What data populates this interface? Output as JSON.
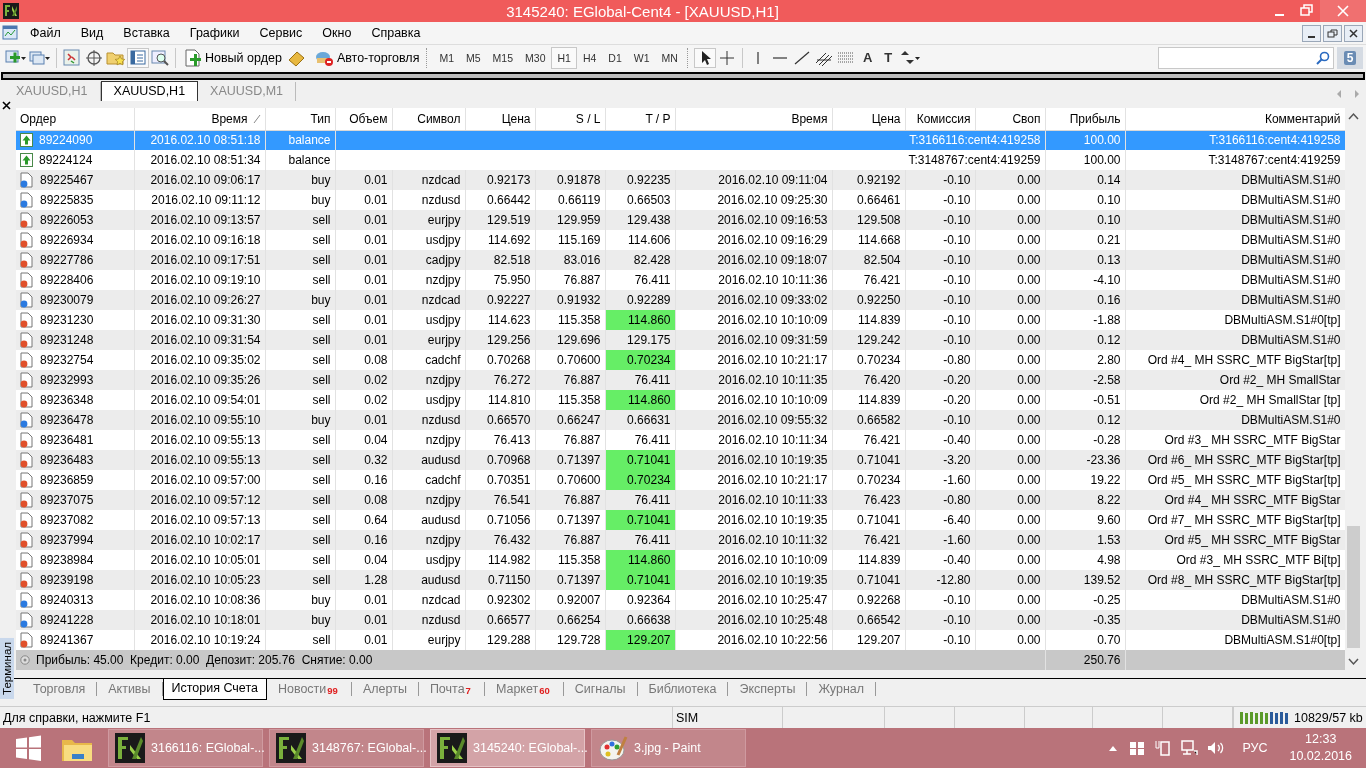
{
  "window": {
    "title": "3145240: EGlobal-Cent4 - [XAUUSD,H1]"
  },
  "menu": [
    "Файл",
    "Вид",
    "Вставка",
    "Графики",
    "Сервис",
    "Окно",
    "Справка"
  ],
  "toolbar": {
    "new_order": "Новый ордер",
    "auto_trading": "Авто-торговля",
    "timeframes": [
      {
        "label": "M1",
        "selected": false
      },
      {
        "label": "M5",
        "selected": false
      },
      {
        "label": "M15",
        "selected": false
      },
      {
        "label": "M30",
        "selected": false
      },
      {
        "label": "H1",
        "selected": true
      },
      {
        "label": "H4",
        "selected": false
      },
      {
        "label": "D1",
        "selected": false
      },
      {
        "label": "W1",
        "selected": false
      },
      {
        "label": "MN",
        "selected": false
      }
    ],
    "text_tools": [
      "A",
      "T"
    ],
    "chat_count": "5"
  },
  "chart_tabs": [
    {
      "label": "XAUUSD,H1",
      "selected": false
    },
    {
      "label": "XAUUSD,H1",
      "selected": true
    },
    {
      "label": "XAUUSD,M1",
      "selected": false
    }
  ],
  "terminal": {
    "title": "Терминал",
    "columns": [
      {
        "label": "Ордер",
        "sorted": false
      },
      {
        "label": "Время",
        "sorted": true
      },
      {
        "label": "Тип",
        "sorted": false
      },
      {
        "label": "Объем",
        "sorted": false
      },
      {
        "label": "Символ",
        "sorted": false
      },
      {
        "label": "Цена",
        "sorted": false
      },
      {
        "label": "S / L",
        "sorted": false
      },
      {
        "label": "T / P",
        "sorted": false
      },
      {
        "label": "Время",
        "sorted": false
      },
      {
        "label": "Цена",
        "sorted": false
      },
      {
        "label": "Комиссия",
        "sorted": false
      },
      {
        "label": "Своп",
        "sorted": false
      },
      {
        "label": "Прибыль",
        "sorted": false
      },
      {
        "label": "Комментарий",
        "sorted": false
      }
    ],
    "rows": [
      {
        "kind": "balance",
        "selected": true,
        "cells": [
          "89224090",
          "2016.02.10 08:51:18",
          "balance"
        ],
        "note": "T:3166116:cent4:419258",
        "profit": "100.00",
        "comment": "T:3166116:cent4:419258"
      },
      {
        "kind": "balance",
        "selected": false,
        "cells": [
          "89224124",
          "2016.02.10 08:51:34",
          "balance"
        ],
        "note": "T:3148767:cent4:419259",
        "profit": "100.00",
        "comment": "T:3148767:cent4:419259"
      },
      {
        "kind": "buy",
        "selected": false,
        "tp_hit": false,
        "cells": [
          "89225467",
          "2016.02.10 09:06:17",
          "buy",
          "0.01",
          "nzdcad",
          "0.92173",
          "0.91878",
          "0.92235",
          "2016.02.10 09:11:04",
          "0.92192",
          "-0.10",
          "0.00",
          "0.14",
          "DBMultiASM.S1#0"
        ]
      },
      {
        "kind": "buy",
        "selected": false,
        "tp_hit": false,
        "cells": [
          "89225835",
          "2016.02.10 09:11:12",
          "buy",
          "0.01",
          "nzdusd",
          "0.66442",
          "0.66119",
          "0.66503",
          "2016.02.10 09:25:30",
          "0.66461",
          "-0.10",
          "0.00",
          "0.10",
          "DBMultiASM.S1#0"
        ]
      },
      {
        "kind": "sell",
        "selected": false,
        "tp_hit": false,
        "cells": [
          "89226053",
          "2016.02.10 09:13:57",
          "sell",
          "0.01",
          "eurjpy",
          "129.519",
          "129.959",
          "129.438",
          "2016.02.10 09:16:53",
          "129.508",
          "-0.10",
          "0.00",
          "0.10",
          "DBMultiASM.S1#0"
        ]
      },
      {
        "kind": "sell",
        "selected": false,
        "tp_hit": false,
        "cells": [
          "89226934",
          "2016.02.10 09:16:18",
          "sell",
          "0.01",
          "usdjpy",
          "114.692",
          "115.169",
          "114.606",
          "2016.02.10 09:16:29",
          "114.668",
          "-0.10",
          "0.00",
          "0.21",
          "DBMultiASM.S1#0"
        ]
      },
      {
        "kind": "sell",
        "selected": false,
        "tp_hit": false,
        "cells": [
          "89227786",
          "2016.02.10 09:17:51",
          "sell",
          "0.01",
          "cadjpy",
          "82.518",
          "83.016",
          "82.428",
          "2016.02.10 09:18:07",
          "82.504",
          "-0.10",
          "0.00",
          "0.13",
          "DBMultiASM.S1#0"
        ]
      },
      {
        "kind": "sell",
        "selected": false,
        "tp_hit": false,
        "cells": [
          "89228406",
          "2016.02.10 09:19:10",
          "sell",
          "0.01",
          "nzdjpy",
          "75.950",
          "76.887",
          "76.411",
          "2016.02.10 10:11:36",
          "76.421",
          "-0.10",
          "0.00",
          "-4.10",
          "DBMultiASM.S1#0"
        ]
      },
      {
        "kind": "buy",
        "selected": false,
        "tp_hit": false,
        "cells": [
          "89230079",
          "2016.02.10 09:26:27",
          "buy",
          "0.01",
          "nzdcad",
          "0.92227",
          "0.91932",
          "0.92289",
          "2016.02.10 09:33:02",
          "0.92250",
          "-0.10",
          "0.00",
          "0.16",
          "DBMultiASM.S1#0"
        ]
      },
      {
        "kind": "sell",
        "selected": false,
        "tp_hit": true,
        "cells": [
          "89231230",
          "2016.02.10 09:31:30",
          "sell",
          "0.01",
          "usdjpy",
          "114.623",
          "115.358",
          "114.860",
          "2016.02.10 10:10:09",
          "114.839",
          "-0.10",
          "0.00",
          "-1.88",
          "DBMultiASM.S1#0[tp]"
        ]
      },
      {
        "kind": "sell",
        "selected": false,
        "tp_hit": false,
        "cells": [
          "89231248",
          "2016.02.10 09:31:54",
          "sell",
          "0.01",
          "eurjpy",
          "129.256",
          "129.696",
          "129.175",
          "2016.02.10 09:31:59",
          "129.242",
          "-0.10",
          "0.00",
          "0.12",
          "DBMultiASM.S1#0"
        ]
      },
      {
        "kind": "sell",
        "selected": false,
        "tp_hit": true,
        "cells": [
          "89232754",
          "2016.02.10 09:35:02",
          "sell",
          "0.08",
          "cadchf",
          "0.70268",
          "0.70600",
          "0.70234",
          "2016.02.10 10:21:17",
          "0.70234",
          "-0.80",
          "0.00",
          "2.80",
          "Ord #4_ MH SSRC_MTF BigStar[tp]"
        ]
      },
      {
        "kind": "sell",
        "selected": false,
        "tp_hit": false,
        "cells": [
          "89232993",
          "2016.02.10 09:35:26",
          "sell",
          "0.02",
          "nzdjpy",
          "76.272",
          "76.887",
          "76.411",
          "2016.02.10 10:11:35",
          "76.420",
          "-0.20",
          "0.00",
          "-2.58",
          "Ord #2_ MH SmallStar"
        ]
      },
      {
        "kind": "sell",
        "selected": false,
        "tp_hit": true,
        "cells": [
          "89236348",
          "2016.02.10 09:54:01",
          "sell",
          "0.02",
          "usdjpy",
          "114.810",
          "115.358",
          "114.860",
          "2016.02.10 10:10:09",
          "114.839",
          "-0.20",
          "0.00",
          "-0.51",
          "Ord #2_ MH SmallStar [tp]"
        ]
      },
      {
        "kind": "buy",
        "selected": false,
        "tp_hit": false,
        "cells": [
          "89236478",
          "2016.02.10 09:55:10",
          "buy",
          "0.01",
          "nzdusd",
          "0.66570",
          "0.66247",
          "0.66631",
          "2016.02.10 09:55:32",
          "0.66582",
          "-0.10",
          "0.00",
          "0.12",
          "DBMultiASM.S1#0"
        ]
      },
      {
        "kind": "sell",
        "selected": false,
        "tp_hit": false,
        "cells": [
          "89236481",
          "2016.02.10 09:55:13",
          "sell",
          "0.04",
          "nzdjpy",
          "76.413",
          "76.887",
          "76.411",
          "2016.02.10 10:11:34",
          "76.421",
          "-0.40",
          "0.00",
          "-0.28",
          "Ord #3_ MH SSRC_MTF BigStar"
        ]
      },
      {
        "kind": "sell",
        "selected": false,
        "tp_hit": true,
        "cells": [
          "89236483",
          "2016.02.10 09:55:13",
          "sell",
          "0.32",
          "audusd",
          "0.70968",
          "0.71397",
          "0.71041",
          "2016.02.10 10:19:35",
          "0.71041",
          "-3.20",
          "0.00",
          "-23.36",
          "Ord #6_ MH SSRC_MTF BigStar[tp]"
        ]
      },
      {
        "kind": "sell",
        "selected": false,
        "tp_hit": true,
        "cells": [
          "89236859",
          "2016.02.10 09:57:00",
          "sell",
          "0.16",
          "cadchf",
          "0.70351",
          "0.70600",
          "0.70234",
          "2016.02.10 10:21:17",
          "0.70234",
          "-1.60",
          "0.00",
          "19.22",
          "Ord #5_ MH SSRC_MTF BigStar[tp]"
        ]
      },
      {
        "kind": "sell",
        "selected": false,
        "tp_hit": false,
        "cells": [
          "89237075",
          "2016.02.10 09:57:12",
          "sell",
          "0.08",
          "nzdjpy",
          "76.541",
          "76.887",
          "76.411",
          "2016.02.10 10:11:33",
          "76.423",
          "-0.80",
          "0.00",
          "8.22",
          "Ord #4_ MH SSRC_MTF BigStar"
        ]
      },
      {
        "kind": "sell",
        "selected": false,
        "tp_hit": true,
        "cells": [
          "89237082",
          "2016.02.10 09:57:13",
          "sell",
          "0.64",
          "audusd",
          "0.71056",
          "0.71397",
          "0.71041",
          "2016.02.10 10:19:35",
          "0.71041",
          "-6.40",
          "0.00",
          "9.60",
          "Ord #7_ MH SSRC_MTF BigStar[tp]"
        ]
      },
      {
        "kind": "sell",
        "selected": false,
        "tp_hit": false,
        "cells": [
          "89237994",
          "2016.02.10 10:02:17",
          "sell",
          "0.16",
          "nzdjpy",
          "76.432",
          "76.887",
          "76.411",
          "2016.02.10 10:11:32",
          "76.421",
          "-1.60",
          "0.00",
          "1.53",
          "Ord #5_ MH SSRC_MTF BigStar"
        ]
      },
      {
        "kind": "sell",
        "selected": false,
        "tp_hit": true,
        "cells": [
          "89238984",
          "2016.02.10 10:05:01",
          "sell",
          "0.04",
          "usdjpy",
          "114.982",
          "115.358",
          "114.860",
          "2016.02.10 10:10:09",
          "114.839",
          "-0.40",
          "0.00",
          "4.98",
          "Ord #3_ MH SSRC_MTF Bi[tp]"
        ]
      },
      {
        "kind": "sell",
        "selected": false,
        "tp_hit": true,
        "cells": [
          "89239198",
          "2016.02.10 10:05:23",
          "sell",
          "1.28",
          "audusd",
          "0.71150",
          "0.71397",
          "0.71041",
          "2016.02.10 10:19:35",
          "0.71041",
          "-12.80",
          "0.00",
          "139.52",
          "Ord #8_ MH SSRC_MTF BigStar[tp]"
        ]
      },
      {
        "kind": "buy",
        "selected": false,
        "tp_hit": false,
        "cells": [
          "89240313",
          "2016.02.10 10:08:36",
          "buy",
          "0.01",
          "nzdcad",
          "0.92302",
          "0.92007",
          "0.92364",
          "2016.02.10 10:25:47",
          "0.92268",
          "-0.10",
          "0.00",
          "-0.25",
          "DBMultiASM.S1#0"
        ]
      },
      {
        "kind": "buy",
        "selected": false,
        "tp_hit": false,
        "cells": [
          "89241228",
          "2016.02.10 10:18:01",
          "buy",
          "0.01",
          "nzdusd",
          "0.66577",
          "0.66254",
          "0.66638",
          "2016.02.10 10:25:48",
          "0.66542",
          "-0.10",
          "0.00",
          "-0.35",
          "DBMultiASM.S1#0"
        ]
      },
      {
        "kind": "sell",
        "selected": false,
        "tp_hit": true,
        "cells": [
          "89241367",
          "2016.02.10 10:19:24",
          "sell",
          "0.01",
          "eurjpy",
          "129.288",
          "129.728",
          "129.207",
          "2016.02.10 10:22:56",
          "129.207",
          "-0.10",
          "0.00",
          "0.70",
          "DBMultiASM.S1#0[tp]"
        ]
      }
    ],
    "summary": {
      "text": "Прибыль: 45.00  Кредит: 0.00  Депозит: 205.76  Снятие: 0.00",
      "profit": "250.76"
    },
    "tabs": [
      {
        "label": "Торговля",
        "selected": false
      },
      {
        "label": "Активы",
        "selected": false
      },
      {
        "label": "История Счета",
        "selected": true
      },
      {
        "label": "Новости",
        "badge": "99",
        "selected": false
      },
      {
        "label": "Алерты",
        "selected": false
      },
      {
        "label": "Почта",
        "badge": "7",
        "selected": false
      },
      {
        "label": "Маркет",
        "badge": "60",
        "selected": false
      },
      {
        "label": "Сигналы",
        "selected": false
      },
      {
        "label": "Библиотека",
        "selected": false
      },
      {
        "label": "Эксперты",
        "selected": false
      },
      {
        "label": "Журнал",
        "selected": false
      }
    ]
  },
  "status_bar": {
    "help": "Для справки, нажмите F1",
    "server": "SIM",
    "traffic": "10829/57 kb"
  },
  "taskbar": {
    "items": [
      {
        "label": "3166116: EGlobal-...",
        "kind": "terminal",
        "selected": false
      },
      {
        "label": "3148767: EGlobal-...",
        "kind": "terminal",
        "selected": false
      },
      {
        "label": "3145240: EGlobal-...",
        "kind": "terminal",
        "selected": true
      },
      {
        "label": "3.jpg - Paint",
        "kind": "paint",
        "selected": false
      }
    ],
    "language": "РУС",
    "time": "12:33",
    "date": "10.02.2016"
  }
}
